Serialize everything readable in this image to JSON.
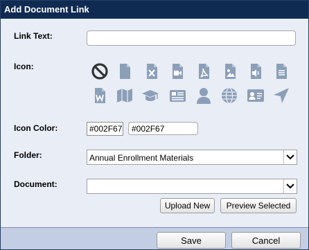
{
  "dialog": {
    "title": "Add Document Link"
  },
  "fields": {
    "link_text_label": "Link Text:",
    "link_text_value": "",
    "icon_label": "Icon:",
    "icon_color_label": "Icon Color:",
    "icon_color_swatch": "#002F67",
    "icon_color_value": "#002F67",
    "folder_label": "Folder:",
    "folder_value": "Annual Enrollment Materials",
    "document_label": "Document:",
    "document_value": ""
  },
  "icons": [
    "no-icon-option",
    "document-icon",
    "excel-icon",
    "video-icon",
    "pdf-icon",
    "image-icon",
    "audio-icon",
    "text-file-icon",
    "word-icon",
    "map-icon",
    "graduation-cap-icon",
    "newspaper-icon",
    "person-icon",
    "globe-icon",
    "contact-card-icon",
    "location-arrow-icon"
  ],
  "buttons": {
    "upload_new": "Upload New",
    "preview_selected": "Preview Selected",
    "save": "Save",
    "cancel": "Cancel"
  },
  "colors": {
    "title_bar": "#102B52",
    "dialog_bg": "#E8EDF6",
    "footer_bg": "#C3CDE3",
    "icon_gray": "#8C9FB8",
    "selected_icon": "#333333"
  }
}
